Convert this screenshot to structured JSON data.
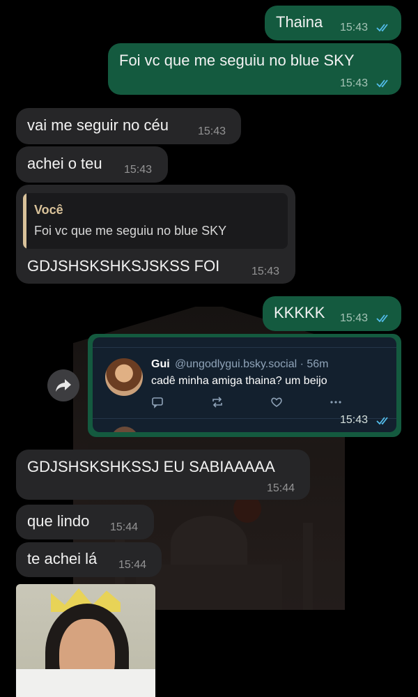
{
  "chat": {
    "messages": [
      {
        "id": "m1",
        "direction": "outgoing",
        "text": "Thaina",
        "time": "15:43",
        "read": true
      },
      {
        "id": "m2",
        "direction": "outgoing",
        "text": "Foi vc que me seguiu no blue SKY",
        "time": "15:43",
        "read": true
      },
      {
        "id": "m3",
        "direction": "incoming",
        "text": "vai me seguir no céu",
        "time": "15:43"
      },
      {
        "id": "m4",
        "direction": "incoming",
        "text": "achei o teu",
        "time": "15:43"
      },
      {
        "id": "m5",
        "direction": "incoming",
        "quote": {
          "author": "Você",
          "text": "Foi vc que me seguiu no blue SKY"
        },
        "text": "GDJSHSKSHKSJSKSS FOI",
        "time": "15:43"
      },
      {
        "id": "m6",
        "direction": "outgoing",
        "text": "KKKKK",
        "time": "15:43",
        "read": true
      },
      {
        "id": "m7",
        "direction": "outgoing",
        "time": "15:43",
        "read": true,
        "embed": {
          "name": "Gui",
          "handle": "@ungodlygui.bsky.social · 56m",
          "text": "cadê minha amiga thaina? um beijo",
          "icons": [
            "reply-icon",
            "repost-icon",
            "like-icon",
            "more-icon"
          ]
        }
      },
      {
        "id": "m8",
        "direction": "incoming",
        "text": "GDJSHSKSHKSSJ EU SABIAAAAA",
        "time": "15:44"
      },
      {
        "id": "m9",
        "direction": "incoming",
        "text": "que lindo",
        "time": "15:44"
      },
      {
        "id": "m10",
        "direction": "incoming",
        "text": "te achei lá",
        "time": "15:44"
      },
      {
        "id": "m11",
        "direction": "incoming",
        "type": "image"
      }
    ]
  },
  "colors": {
    "background": "#000000",
    "incoming_bubble": "#262628",
    "outgoing_bubble": "#145a3f",
    "read_ticks": "#53bdeb",
    "quote_accent": "#d9c29a",
    "embed_background": "#13202e"
  }
}
